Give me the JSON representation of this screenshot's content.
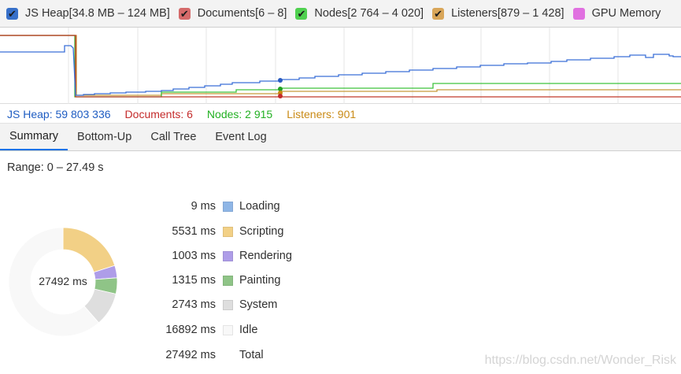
{
  "legend": [
    {
      "label": "JS Heap[34.8 MB – 124 MB]",
      "color": "#3770c9",
      "checked": true
    },
    {
      "label": "Documents[6 – 8]",
      "color": "#d56a6a",
      "checked": true
    },
    {
      "label": "Nodes[2 764 – 4 020]",
      "color": "#4fd04f",
      "checked": true
    },
    {
      "label": "Listeners[879 – 1 428]",
      "color": "#d9a659",
      "checked": true
    },
    {
      "label": "GPU Memory",
      "color": "#e070e0",
      "checked": false
    }
  ],
  "counters": [
    {
      "label": "JS Heap: 59 803 336",
      "color": "#1e5cc2"
    },
    {
      "label": "Documents: 6",
      "color": "#c42b2b"
    },
    {
      "label": "Nodes: 2 915",
      "color": "#22b022"
    },
    {
      "label": "Listeners: 901",
      "color": "#c98a15"
    }
  ],
  "tabs": [
    {
      "label": "Summary",
      "active": true
    },
    {
      "label": "Bottom-Up",
      "active": false
    },
    {
      "label": "Call Tree",
      "active": false
    },
    {
      "label": "Event Log",
      "active": false
    }
  ],
  "summary": {
    "range": "Range: 0 – 27.49 s",
    "donut_label": "27492 ms",
    "rows": [
      {
        "value": "9 ms",
        "category": "Loading",
        "color": "#8fb6e6",
        "ms": 9
      },
      {
        "value": "5531 ms",
        "category": "Scripting",
        "color": "#f2d086",
        "ms": 5531
      },
      {
        "value": "1003 ms",
        "category": "Rendering",
        "color": "#ae9de8",
        "ms": 1003
      },
      {
        "value": "1315 ms",
        "category": "Painting",
        "color": "#8fc487",
        "ms": 1315
      },
      {
        "value": "2743 ms",
        "category": "System",
        "color": "#dedede",
        "ms": 2743
      },
      {
        "value": "16892 ms",
        "category": "Idle",
        "color": "#f8f8f8",
        "ms": 16892
      }
    ],
    "total": {
      "value": "27492 ms",
      "category": "Total",
      "ms": 27492
    }
  },
  "watermark": "https://blog.csdn.net/Wonder_Risk"
}
